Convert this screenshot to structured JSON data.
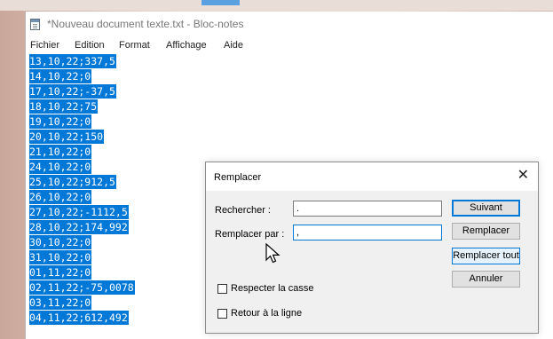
{
  "window": {
    "title": "*Nouveau document texte.txt - Bloc-notes"
  },
  "menu": [
    "Fichier",
    "Edition",
    "Format",
    "Affichage",
    "Aide"
  ],
  "lines": [
    "13,10,22;337,5",
    "14,10,22;0",
    "17,10,22;-37,5",
    "18,10,22;75",
    "19,10,22;0",
    "20,10,22;150",
    "21,10,22;0",
    "24,10,22;0",
    "25,10,22;912,5",
    "26,10,22;0",
    "27,10,22;-1112,5",
    "28,10,22;174,992",
    "30,10,22;0",
    "31,10,22;0",
    "01,11,22;0",
    "02,11,22;-75,0078",
    "03,11,22;0",
    "04,11,22;612,492"
  ],
  "dialog": {
    "title": "Remplacer",
    "find_label": "Rechercher :",
    "find_value": ".",
    "replace_label": "Remplacer par :",
    "replace_value": ",",
    "buttons": {
      "next": "Suivant",
      "replace": "Remplacer",
      "replace_all": "Remplacer tout",
      "cancel": "Annuler"
    },
    "match_case": "Respecter la casse",
    "wrap_around": "Retour à la ligne"
  }
}
